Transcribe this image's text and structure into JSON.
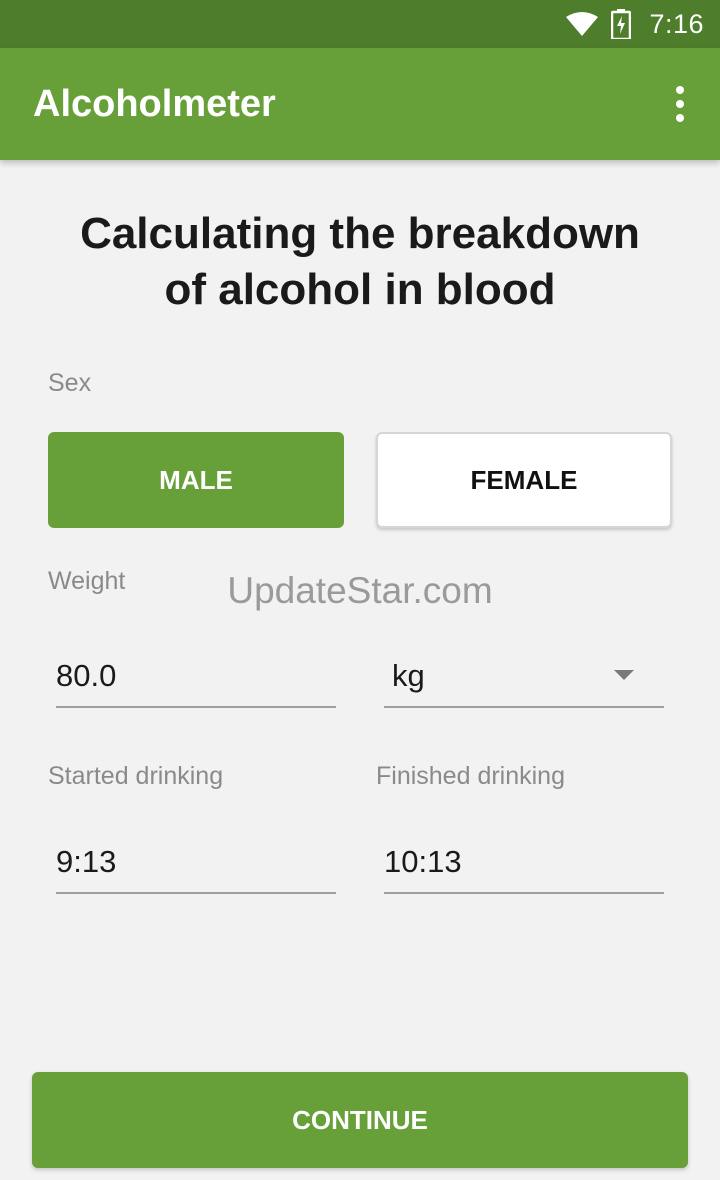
{
  "status_bar": {
    "time": "7:16",
    "icons": [
      "wifi-icon",
      "battery-charging-icon"
    ]
  },
  "app_bar": {
    "title": "Alcoholmeter",
    "menu_icon": "more-vert-icon"
  },
  "heading": {
    "line1": "Calculating the breakdown",
    "line2": "of alcohol in blood"
  },
  "sex": {
    "label": "Sex",
    "male_label": "MALE",
    "female_label": "FEMALE",
    "selected": "MALE"
  },
  "weight": {
    "label": "Weight",
    "value": "80.0",
    "unit": "kg"
  },
  "watermark": "UpdateStar.com",
  "drinking": {
    "started_label": "Started drinking",
    "started_value": "9:13",
    "finished_label": "Finished drinking",
    "finished_value": "10:13"
  },
  "continue_label": "CONTINUE",
  "colors": {
    "primary": "#67a038",
    "primary_dark": "#4e7d2b",
    "background": "#f2f2f2"
  }
}
